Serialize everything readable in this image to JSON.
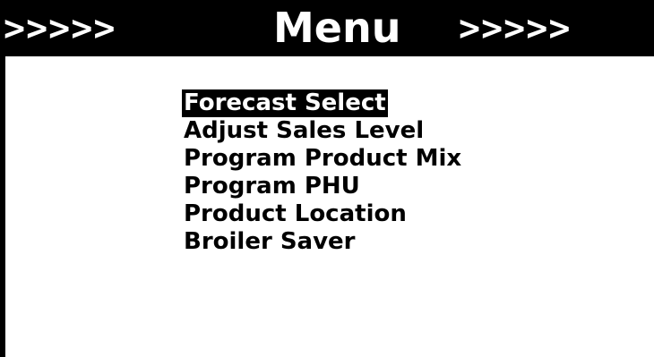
{
  "header": {
    "left_arrows": ">>>>>",
    "title": "Menu",
    "right_arrows": ">>>>>"
  },
  "menu": {
    "selected_index": 0,
    "items": [
      {
        "label": "Forecast Select"
      },
      {
        "label": "Adjust Sales Level"
      },
      {
        "label": "Program Product Mix"
      },
      {
        "label": "Program PHU"
      },
      {
        "label": "Product Location"
      },
      {
        "label": "Broiler Saver"
      }
    ]
  },
  "colors": {
    "background": "#ffffff",
    "header_background": "#000000",
    "text": "#000000",
    "highlight_background": "#000000",
    "highlight_text": "#ffffff"
  }
}
